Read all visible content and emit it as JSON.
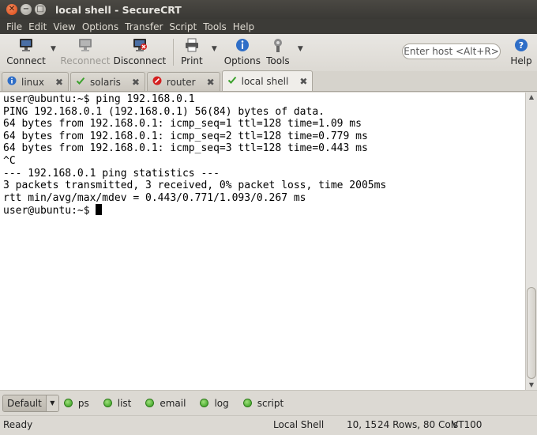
{
  "window": {
    "title": "local shell - SecureCRT"
  },
  "menu": [
    "File",
    "Edit",
    "View",
    "Options",
    "Transfer",
    "Script",
    "Tools",
    "Help"
  ],
  "toolbar": {
    "connect": "Connect",
    "reconnect": "Reconnect",
    "disconnect": "Disconnect",
    "print": "Print",
    "options": "Options",
    "tools": "Tools",
    "host_placeholder": "Enter host <Alt+R>",
    "help": "Help"
  },
  "tabs": [
    {
      "label": "linux",
      "status": "info"
    },
    {
      "label": "solaris",
      "status": "connected"
    },
    {
      "label": "router",
      "status": "error"
    },
    {
      "label": "local shell",
      "status": "connected",
      "active": true
    }
  ],
  "terminal": {
    "lines": [
      "user@ubuntu:~$ ping 192.168.0.1",
      "PING 192.168.0.1 (192.168.0.1) 56(84) bytes of data.",
      "64 bytes from 192.168.0.1: icmp_seq=1 ttl=128 time=1.09 ms",
      "64 bytes from 192.168.0.1: icmp_seq=2 ttl=128 time=0.779 ms",
      "64 bytes from 192.168.0.1: icmp_seq=3 ttl=128 time=0.443 ms",
      "^C",
      "--- 192.168.0.1 ping statistics ---",
      "3 packets transmitted, 3 received, 0% packet loss, time 2005ms",
      "rtt min/avg/max/mdev = 0.443/0.771/1.093/0.267 ms"
    ],
    "prompt": "user@ubuntu:~$ "
  },
  "buttonbar": {
    "default_label": "Default",
    "buttons": [
      "ps",
      "list",
      "email",
      "log",
      "script"
    ]
  },
  "status": {
    "ready": "Ready",
    "session": "Local Shell",
    "cursor": "10, 15",
    "size": "24 Rows, 80 Cols",
    "emulation": "VT100"
  },
  "colors": {
    "titlebar": "#3c3b37",
    "close_button": "#dd4814",
    "status_dot": "#2e9a18"
  }
}
